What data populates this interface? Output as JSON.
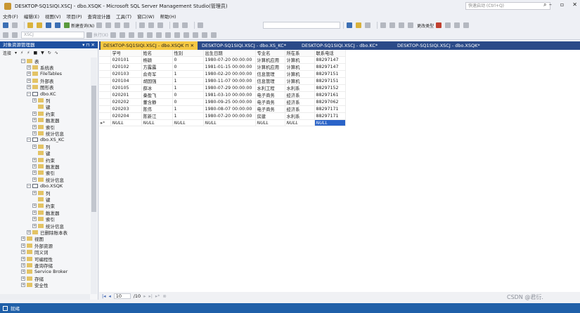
{
  "window": {
    "title": "DESKTOP-SQ1SIQI.XSCJ - dbo.XSQK - Microsoft SQL Server Management Studio(管理员)",
    "quick_launch": "快速启动 (Ctrl+Q)"
  },
  "menu": [
    "文件(F)",
    "编辑(E)",
    "视图(V)",
    "项目(P)",
    "查询设计器",
    "工具(T)",
    "窗口(W)",
    "帮助(H)"
  ],
  "toolbar": {
    "new_query": "新建查询(N)",
    "change_type": "更改类型",
    "database": "XSCJ",
    "execute": "执行(X)"
  },
  "object_explorer": {
    "title": "对象资源管理器",
    "connect": "连接",
    "tree": [
      {
        "label": "表",
        "level": 0,
        "expand": "minus",
        "icon": "folder"
      },
      {
        "label": "系统表",
        "level": 1,
        "expand": "plus",
        "icon": "folder"
      },
      {
        "label": "FileTables",
        "level": 1,
        "expand": "plus",
        "icon": "folder"
      },
      {
        "label": "外部表",
        "level": 1,
        "expand": "plus",
        "icon": "folder"
      },
      {
        "label": "图形表",
        "level": 1,
        "expand": "plus",
        "icon": "folder"
      },
      {
        "label": "dbo.KC",
        "level": 1,
        "expand": "minus",
        "icon": "table"
      },
      {
        "label": "列",
        "level": 2,
        "expand": "plus",
        "icon": "folder"
      },
      {
        "label": "键",
        "level": 2,
        "expand": "none",
        "icon": "folder"
      },
      {
        "label": "约束",
        "level": 2,
        "expand": "plus",
        "icon": "folder"
      },
      {
        "label": "触发器",
        "level": 2,
        "expand": "plus",
        "icon": "folder"
      },
      {
        "label": "索引",
        "level": 2,
        "expand": "plus",
        "icon": "folder"
      },
      {
        "label": "统计信息",
        "level": 2,
        "expand": "plus",
        "icon": "folder"
      },
      {
        "label": "dbo.XS_KC",
        "level": 1,
        "expand": "minus",
        "icon": "table"
      },
      {
        "label": "列",
        "level": 2,
        "expand": "plus",
        "icon": "folder"
      },
      {
        "label": "键",
        "level": 2,
        "expand": "none",
        "icon": "folder"
      },
      {
        "label": "约束",
        "level": 2,
        "expand": "plus",
        "icon": "folder"
      },
      {
        "label": "触发器",
        "level": 2,
        "expand": "plus",
        "icon": "folder"
      },
      {
        "label": "索引",
        "level": 2,
        "expand": "plus",
        "icon": "folder"
      },
      {
        "label": "统计信息",
        "level": 2,
        "expand": "plus",
        "icon": "folder"
      },
      {
        "label": "dbo.XSQK",
        "level": 1,
        "expand": "minus",
        "icon": "table"
      },
      {
        "label": "列",
        "level": 2,
        "expand": "plus",
        "icon": "folder"
      },
      {
        "label": "键",
        "level": 2,
        "expand": "none",
        "icon": "folder"
      },
      {
        "label": "约束",
        "level": 2,
        "expand": "plus",
        "icon": "folder"
      },
      {
        "label": "触发器",
        "level": 2,
        "expand": "plus",
        "icon": "folder"
      },
      {
        "label": "索引",
        "level": 2,
        "expand": "plus",
        "icon": "folder"
      },
      {
        "label": "统计信息",
        "level": 2,
        "expand": "plus",
        "icon": "folder"
      },
      {
        "label": "已删除账本表",
        "level": 1,
        "expand": "plus",
        "icon": "folder"
      },
      {
        "label": "视图",
        "level": 0,
        "expand": "plus",
        "icon": "folder"
      },
      {
        "label": "外部资源",
        "level": 0,
        "expand": "plus",
        "icon": "folder"
      },
      {
        "label": "同义词",
        "level": 0,
        "expand": "plus",
        "icon": "folder"
      },
      {
        "label": "可编程性",
        "level": 0,
        "expand": "plus",
        "icon": "folder"
      },
      {
        "label": "查询存储",
        "level": 0,
        "expand": "plus",
        "icon": "folder"
      },
      {
        "label": "Service Broker",
        "level": 0,
        "expand": "plus",
        "icon": "folder"
      },
      {
        "label": "存储",
        "level": 0,
        "expand": "plus",
        "icon": "folder"
      },
      {
        "label": "安全性",
        "level": 0,
        "expand": "plus",
        "icon": "folder"
      }
    ]
  },
  "tabs": [
    {
      "label": "DESKTOP-SQ1SIQI.XSCJ - dbo.XSQK",
      "active": true
    },
    {
      "label": "DESKTOP-SQ1SIQI.XSCJ - dbo.XS_KC*",
      "active": false
    },
    {
      "label": "DESKTOP-SQ1SIQI.XSCJ - dbo.KC*",
      "active": false
    },
    {
      "label": "DESKTOP-SQ1SIQI.XSCJ - dbo.XSQK*",
      "active": false
    }
  ],
  "grid": {
    "columns": [
      "学号",
      "姓名",
      "性别",
      "出生日期",
      "专业名",
      "所在系",
      "联系电话"
    ],
    "rows": [
      [
        "020101",
        "杨颖",
        "0",
        "1980-07-20 00:00:00",
        "计算机应用",
        "计算机",
        "88297147"
      ],
      [
        "020102",
        "方露露",
        "0",
        "1981-01-15 00:00:00",
        "计算机应用",
        "计算机",
        "88297147"
      ],
      [
        "020103",
        "俞奇军",
        "1",
        "1980-02-20 00:00:00",
        "信息管理",
        "计算机",
        "88297151"
      ],
      [
        "020104",
        "胡国强",
        "1",
        "1980-11-07 00:00:00",
        "信息管理",
        "计算机",
        "88297151"
      ],
      [
        "020105",
        "薛冰",
        "1",
        "1980-07-29 00:00:00",
        "水利工程",
        "水利系",
        "88297152"
      ],
      [
        "020201",
        "秦盈飞",
        "0",
        "1981-03-10 00:00:00",
        "电子商务",
        "经济系",
        "88297161"
      ],
      [
        "020202",
        "董含静",
        "0",
        "1980-09-25 00:00:00",
        "电子商务",
        "经济系",
        "88297062"
      ],
      [
        "020203",
        "陈伟",
        "1",
        "1980-08-07 00:00:00",
        "电子商务",
        "经济系",
        "88297171"
      ],
      [
        "020204",
        "陈新江",
        "1",
        "1980-07-20 00:00:00",
        "房建",
        "水利系",
        "88297171"
      ],
      [
        "NULL",
        "NULL",
        "NULL",
        "NULL",
        "NULL",
        "NULL",
        "NULL"
      ]
    ],
    "new_row_marker": "▸*"
  },
  "navigator": {
    "current": "10",
    "total": "/10"
  },
  "watermark": "CSDN @君衍.",
  "status": "就绪"
}
